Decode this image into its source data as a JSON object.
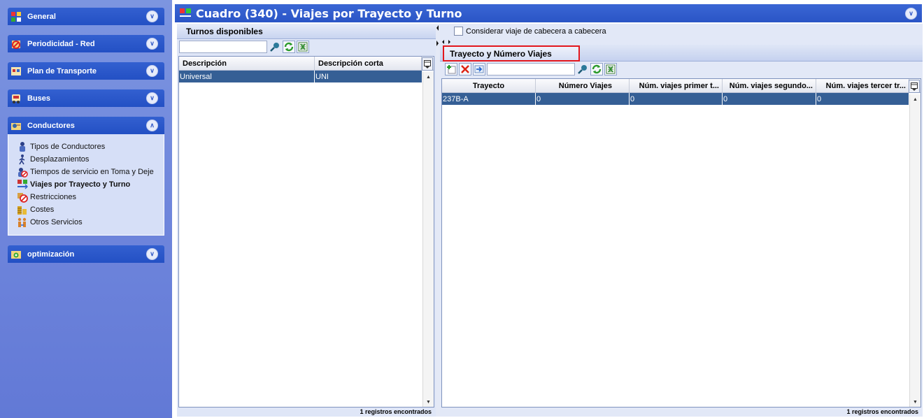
{
  "sidebar": {
    "groups": [
      {
        "label": "General"
      },
      {
        "label": "Periodicidad - Red"
      },
      {
        "label": "Plan de Transporte"
      },
      {
        "label": "Buses"
      },
      {
        "label": "Conductores"
      },
      {
        "label": "optimización"
      }
    ],
    "conductores_items": [
      {
        "label": "Tipos de Conductores",
        "icon": "driver-icon"
      },
      {
        "label": "Desplazamientos",
        "icon": "walking-person-icon"
      },
      {
        "label": "Tiempos de servicio en Toma y Deje",
        "icon": "driver-forbidden-icon"
      },
      {
        "label": "Viajes por Trayecto y Turno",
        "icon": "buses-route-icon"
      },
      {
        "label": "Restricciones",
        "icon": "restriction-icon"
      },
      {
        "label": "Costes",
        "icon": "coins-icon"
      },
      {
        "label": "Otros Servicios",
        "icon": "people-icon"
      }
    ]
  },
  "header": {
    "title": "Cuadro (340) - Viajes por Trayecto y Turno"
  },
  "left_panel": {
    "title": "Turnos disponibles",
    "search_value": "",
    "columns": [
      "Descripción",
      "Descripción corta"
    ],
    "rows": [
      {
        "descripcion": "Universal",
        "descripcion_corta": "UNI"
      }
    ],
    "status": "1 registros encontrados"
  },
  "right_panel": {
    "checkbox_label": "Considerar viaje de cabecera a cabecera",
    "checkbox_checked": false,
    "tab_label": "Trayecto y Número Viajes",
    "search_value": "",
    "columns": [
      "Trayecto",
      "Número Viajes",
      "Núm. viajes primer t...",
      "Núm. viajes segundo...",
      "Núm. viajes tercer tr..."
    ],
    "rows": [
      {
        "trayecto": "237B-A",
        "numero": "0",
        "primer": "0",
        "segundo": "0",
        "tercer": "0"
      }
    ],
    "status": "1 registros encontrados"
  },
  "colors": {
    "header_blue": "#2a55c6",
    "selected_row": "#355f95",
    "highlight_border": "#e3171d",
    "sidebar_bg": "#6f86dc"
  }
}
